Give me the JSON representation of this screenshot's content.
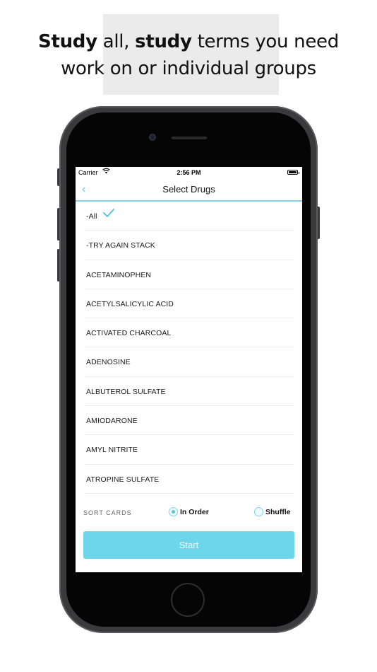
{
  "headline": {
    "line1_bold1": "Study",
    "line1_text1": " all, ",
    "line1_bold2": "study",
    "line1_text2": " terms you need",
    "line2": "work on or individual groups"
  },
  "status_bar": {
    "carrier": "Carrier",
    "time": "2:56 PM"
  },
  "nav": {
    "back_glyph": "‹",
    "title": "Select Drugs"
  },
  "list": {
    "items": [
      {
        "label": "-All",
        "checked": true
      },
      {
        "label": "-TRY AGAIN STACK"
      },
      {
        "label": "ACETAMINOPHEN"
      },
      {
        "label": "ACETYLSALICYLIC ACID"
      },
      {
        "label": "ACTIVATED CHARCOAL"
      },
      {
        "label": "ADENOSINE"
      },
      {
        "label": "ALBUTEROL SULFATE"
      },
      {
        "label": "AMIODARONE"
      },
      {
        "label": "AMYL NITRITE"
      },
      {
        "label": "ATROPINE SULFATE"
      }
    ]
  },
  "sort": {
    "label": "SORT CARDS",
    "options": [
      {
        "label": "In Order",
        "selected": true
      },
      {
        "label": "Shuffle",
        "selected": false
      }
    ]
  },
  "start_label": "Start",
  "colors": {
    "accent": "#5bc6e0",
    "button": "#6dd6ea",
    "divider": "#7fd4e8"
  }
}
